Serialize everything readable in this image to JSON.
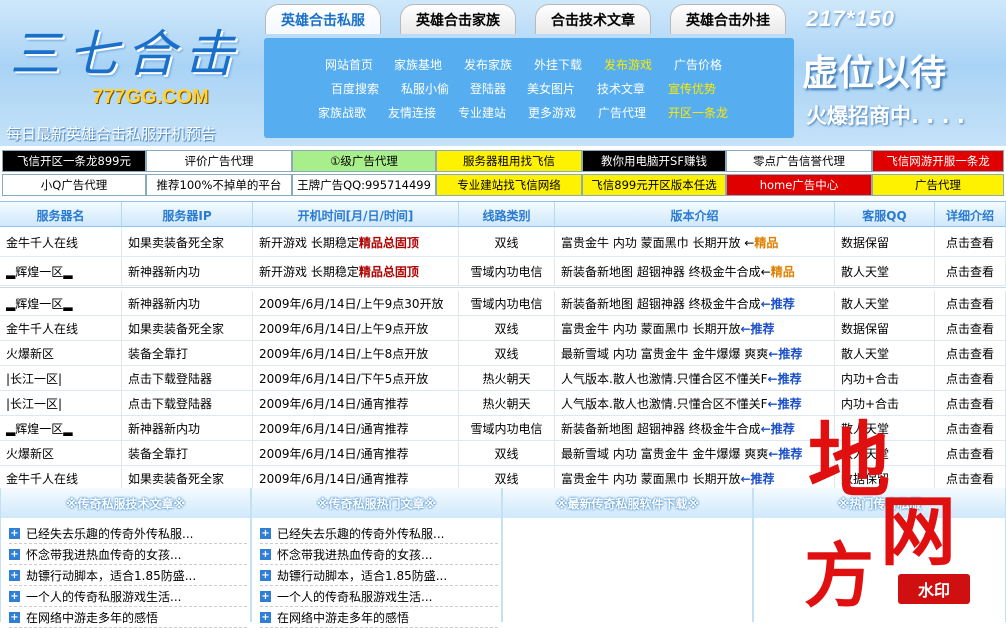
{
  "header": {
    "logo_text": "三七合击",
    "logo_domain": "777GG.COM",
    "slogan": "每日最新英雄合击私服开机预告",
    "tabs": [
      "英雄合击私服",
      "英雄合击家族",
      "合击技术文章",
      "英雄合击外挂"
    ],
    "nav_rows": [
      [
        "网站首页",
        "家族基地",
        "发布家族",
        "外挂下载",
        "发布游戏",
        "广告价格"
      ],
      [
        "百度搜索",
        "私服小偷",
        "登陆器",
        "美女图片",
        "技术文章",
        "宣传优势"
      ],
      [
        "家族战歌",
        "友情连接",
        "专业建站",
        "更多游戏",
        "广告代理",
        "开区一条龙"
      ]
    ],
    "ad_size": "217*150",
    "ad_title": "虚位以待",
    "ad_sub": "火爆招商中. . . ."
  },
  "ad_grid": [
    [
      "飞信开区一条龙899元",
      "评价广告代理",
      "①级广告代理",
      "服务器租用找飞信",
      "教你用电脑开SF赚钱",
      "零点广告信誉代理",
      "飞信网游开服一条龙"
    ],
    [
      "小Q广告代理",
      "推荐100%不掉单的平台",
      "王牌广告QQ:995714499",
      "专业建站找飞信网络",
      "飞信899元开区版本任选",
      "home广告中心",
      "广告代理"
    ]
  ],
  "table": {
    "headers": [
      "服务器名",
      "服务器IP",
      "开机时间[月/日/时间]",
      "线路类别",
      "版本介绍",
      "客服QQ",
      "详细介绍"
    ],
    "featured": [
      [
        "金牛千人在线",
        "如果卖装备死全家",
        "新开游戏 长期稳定 ",
        "精品总固顶",
        "双线",
        "富贵金牛 内功 蒙面黑巾 长期开放 ←",
        "精品",
        "数据保留",
        "点击查看"
      ],
      [
        "▂辉煌一区▂",
        "新神器新内功",
        "新开游戏 长期稳定 ",
        "精品总固顶",
        "雪域内功电信",
        "新装备新地图 超铟神器 终极金牛合成←",
        "精品",
        "散人天堂",
        "点击查看"
      ]
    ],
    "rows": [
      [
        "▂辉煌一区▂",
        "新神器新内功",
        "2009年/6月/14日/上午9点30开放",
        "雪域内功电信",
        "新装备新地图 超铟神器 终极金牛合成",
        "←推荐",
        "散人天堂",
        "点击查看"
      ],
      [
        "金牛千人在线",
        "如果卖装备死全家",
        "2009年/6月/14日/上午9点开放",
        "双线",
        "富贵金牛 内功 蒙面黑巾 长期开放 ",
        "←推荐",
        "数据保留",
        "点击查看"
      ],
      [
        "火爆新区",
        "装备全靠打",
        "2009年/6月/14日/上午8点开放",
        "双线",
        "最新雪域 内功 富贵金牛 金牛爆爆 爽爽",
        "←推荐",
        "散人天堂",
        "点击查看"
      ],
      [
        "|长江一区|",
        "点击下载登陆器",
        "2009年/6月/14日/下午5点开放",
        "热火朝天",
        "人气版本.散人也激情.只懂合区不懂关F",
        "←推荐",
        "内功+合击",
        "点击查看"
      ],
      [
        "|长江一区|",
        "点击下载登陆器",
        "2009年/6月/14日/通宵推荐",
        "热火朝天",
        "人气版本.散人也激情.只懂合区不懂关F",
        "←推荐",
        "内功+合击",
        "点击查看"
      ],
      [
        "▂辉煌一区▂",
        "新神器新内功",
        "2009年/6月/14日/通宵推荐",
        "雪域内功电信",
        "新装备新地图 超铟神器 终极金牛合成",
        "←推荐",
        "散人天堂",
        "点击查看"
      ],
      [
        "火爆新区",
        "装备全靠打",
        "2009年/6月/14日/通宵推荐",
        "双线",
        "最新雪域 内功 富贵金牛 金牛爆爆 爽爽",
        "←推荐",
        "散人天堂",
        "点击查看"
      ],
      [
        "金牛千人在线",
        "如果卖装备死全家",
        "2009年/6月/14日/通宵推荐",
        "双线",
        "富贵金牛 内功 蒙面黑巾 长期开放 ",
        "←推荐",
        "数据保留",
        "点击查看"
      ]
    ]
  },
  "articles": {
    "columns": [
      "※传奇私服技术文章※",
      "※传奇私服热门文章※",
      "※最新传奇私服软件下载※",
      "※热门传奇私服"
    ],
    "items": [
      "已经失去乐趣的传奇外传私服...",
      "怀念带我进热血传奇的女孩...",
      "劫镖行动脚本，适合1.85防盛...",
      "一个人的传奇私服游戏生活...",
      "在网络中游走多年的感悟"
    ]
  },
  "watermark": {
    "text1": "地",
    "text2": "网",
    "text3": "方",
    "badge": "水印"
  },
  "colors": {
    "accent": "#2a7bd1",
    "nav_bg": "#56aef0",
    "tag_red": "#b00000",
    "tag_blue": "#1a4fc8",
    "watermark_red": "#e01010"
  }
}
